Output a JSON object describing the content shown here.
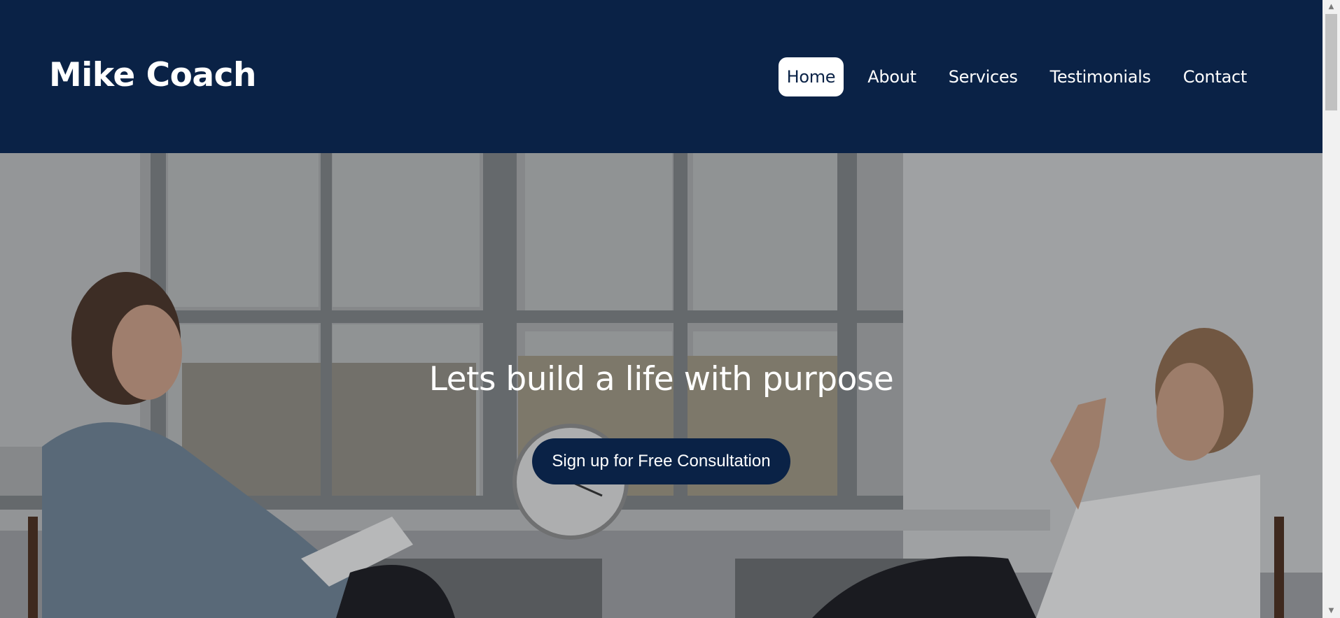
{
  "brand": {
    "name": "Mike Coach"
  },
  "nav": {
    "items": [
      {
        "label": "Home",
        "active": true
      },
      {
        "label": "About",
        "active": false
      },
      {
        "label": "Services",
        "active": false
      },
      {
        "label": "Testimonials",
        "active": false
      },
      {
        "label": "Contact",
        "active": false
      }
    ]
  },
  "hero": {
    "title": "Lets build a life with purpose",
    "cta_label": "Sign up for Free Consultation",
    "image_icon": "coaching-session-photo-icon"
  },
  "colors": {
    "header_bg": "#0a2246",
    "button_bg": "#0a2246",
    "text_light": "#ffffff"
  }
}
